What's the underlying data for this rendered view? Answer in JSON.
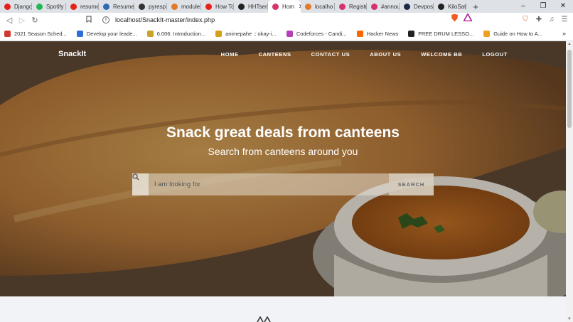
{
  "browser": {
    "tabs": [
      {
        "label": "Django",
        "color": "#e62117"
      },
      {
        "label": "Spotify",
        "color": "#1db954"
      },
      {
        "label": "resume",
        "color": "#e62117"
      },
      {
        "label": "Resume",
        "color": "#2d6bb5"
      },
      {
        "label": "pyresp",
        "color": "#333333"
      },
      {
        "label": "module",
        "color": "#e07b2a"
      },
      {
        "label": "How To",
        "color": "#e62117"
      },
      {
        "label": "HHTsen",
        "color": "#222222"
      },
      {
        "label": "Hom",
        "color": "#d6336c"
      },
      {
        "label": "localho",
        "color": "#e07b2a"
      },
      {
        "label": "Registr",
        "color": "#d6336c"
      },
      {
        "label": "#annou",
        "color": "#d6336c"
      },
      {
        "label": "Devpost",
        "color": "#1c2a44"
      },
      {
        "label": "KiloSat",
        "color": "#222222"
      }
    ],
    "active_tab_index": 8,
    "new_tab": "+",
    "window_controls": {
      "minimize": "–",
      "maximize": "❐",
      "close": "✕"
    },
    "url": "localhost/SnackIt-master/index.php",
    "bookmarks": [
      {
        "label": "2021 Season Sched...",
        "color": "#d13a2e"
      },
      {
        "label": "Develop your leade...",
        "color": "#2b6fd6"
      },
      {
        "label": "6.006: Introduction...",
        "color": "#c9a227"
      },
      {
        "label": "animepahe :: okay-i...",
        "color": "#d4a017"
      },
      {
        "label": "Codeforces - Candi...",
        "color": "#b63fb5"
      },
      {
        "label": "Hacker News",
        "color": "#ff6600"
      },
      {
        "label": "FREE DRUM LESSO...",
        "color": "#222222"
      },
      {
        "label": "Guide on How to A...",
        "color": "#f0a020"
      }
    ],
    "bookmarks_more": "»"
  },
  "site": {
    "brand": "SnackIt",
    "nav": [
      "HOME",
      "CANTEENS",
      "CONTACT US",
      "ABOUT US",
      "WELCOME BB",
      "LOGOUT"
    ],
    "hero": {
      "title": "Snack great deals from canteens",
      "subtitle": "Search from canteens around you"
    },
    "search": {
      "placeholder": "I am looking for",
      "button": "SEARCH"
    }
  },
  "colors": {
    "tabstrip": "#dee1e6",
    "section_bg": "#f1f3f6"
  }
}
